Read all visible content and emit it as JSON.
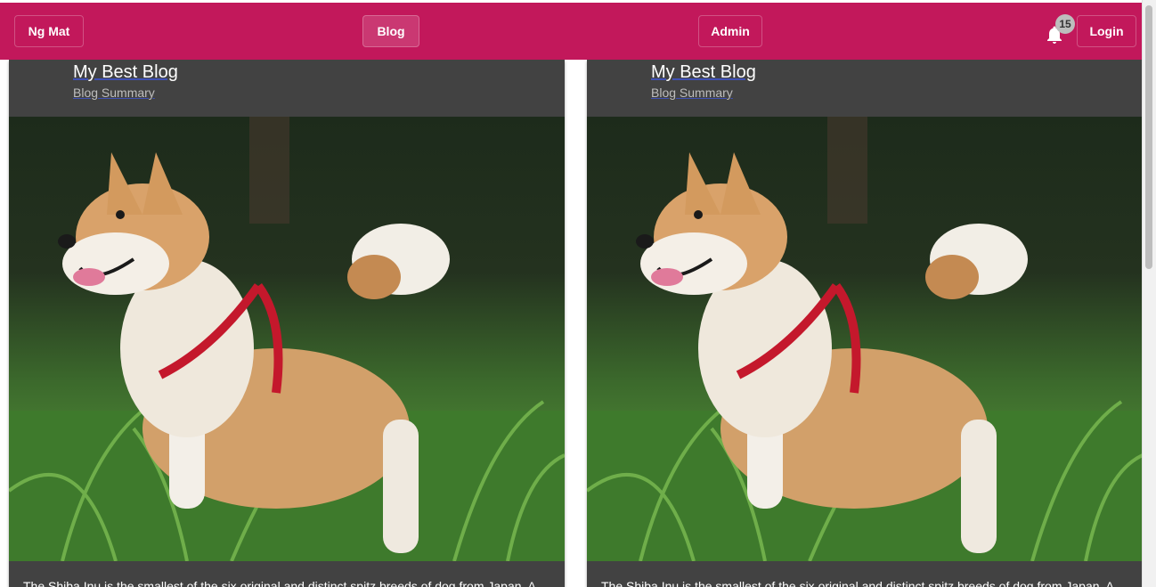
{
  "toolbar": {
    "brand_label": "Ng Mat",
    "blog_label": "Blog",
    "admin_label": "Admin",
    "login_label": "Login",
    "notification_count": "15",
    "notification_icon": "bell-icon",
    "background_color": "#c2185b"
  },
  "cards": [
    {
      "title": "My Best Blog",
      "subtitle": "Blog Summary",
      "image_subject": "shiba-inu-dog-photo",
      "text": "The Shiba Inu is the smallest of the six original and distinct spitz breeds of dog from Japan. A"
    },
    {
      "title": "My Best Blog",
      "subtitle": "Blog Summary",
      "image_subject": "shiba-inu-dog-photo",
      "text": "The Shiba Inu is the smallest of the six original and distinct spitz breeds of dog from Japan. A"
    }
  ]
}
